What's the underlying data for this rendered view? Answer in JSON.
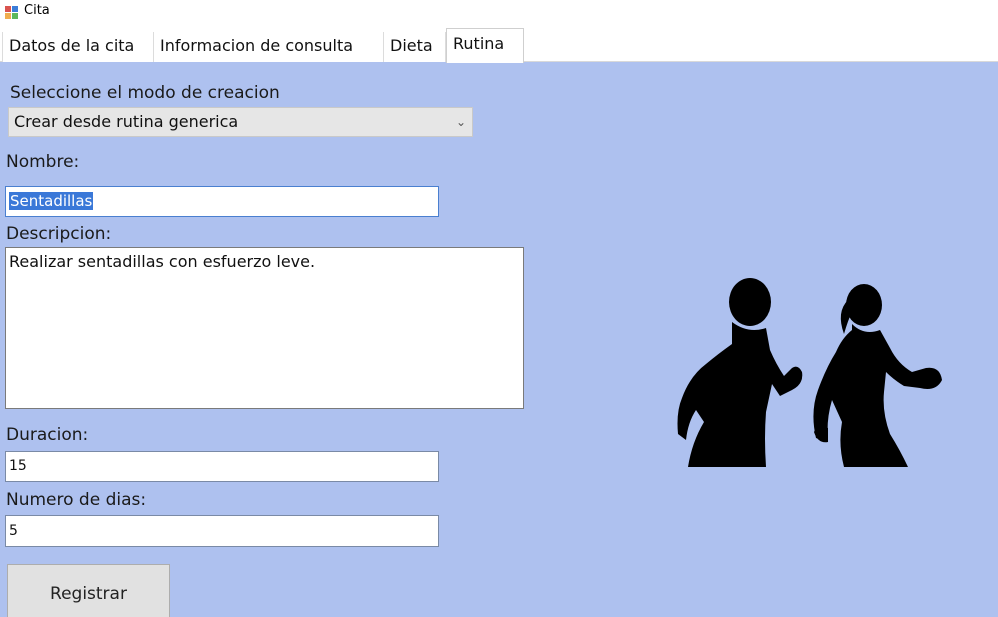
{
  "window": {
    "title": "Cita"
  },
  "tabs": [
    {
      "label": "Datos de la cita",
      "active": false
    },
    {
      "label": "Informacion de consulta",
      "active": false
    },
    {
      "label": "Dieta",
      "active": false
    },
    {
      "label": "Rutina",
      "active": true
    }
  ],
  "form": {
    "mode_label": "Seleccione el modo de creacion",
    "mode_value": "Crear desde rutina generica",
    "name_label": "Nombre:",
    "name_value": "Sentadillas",
    "description_label": "Descripcion:",
    "description_value": "Realizar sentadillas con esfuerzo leve.",
    "duration_label": "Duracion:",
    "duration_value": "15",
    "days_label": "Numero de dias:",
    "days_value": "5",
    "submit_label": "Registrar"
  },
  "colors": {
    "panel_background": "#aec1ef",
    "selection_highlight": "#3a78d8"
  },
  "illustration": {
    "icon": "runners-silhouette-icon"
  }
}
